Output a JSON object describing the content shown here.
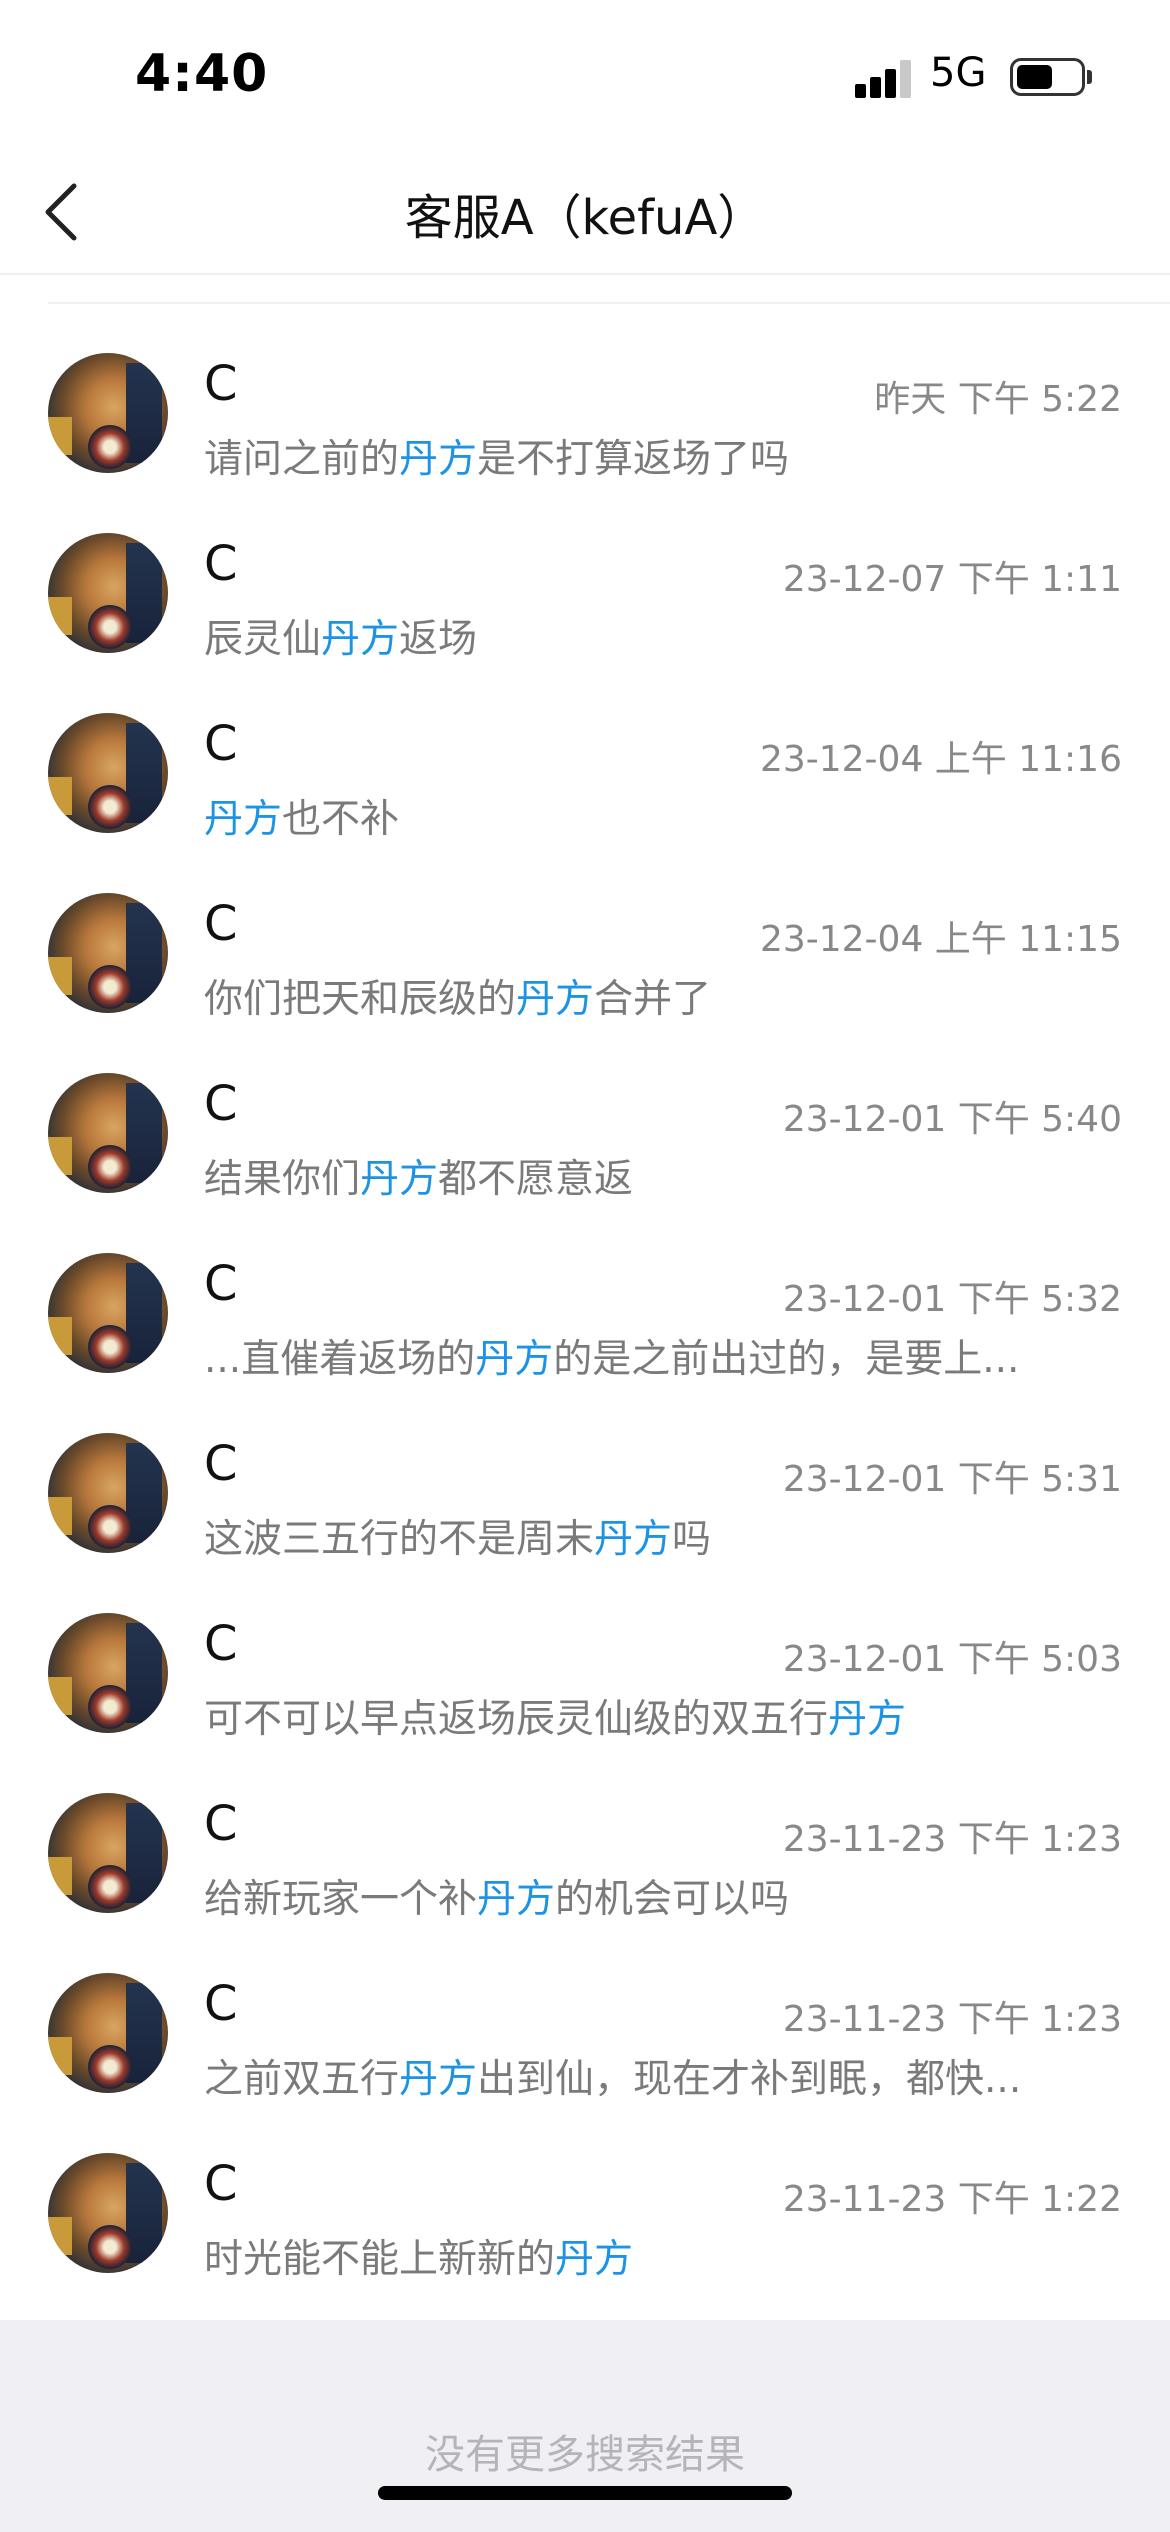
{
  "status_bar": {
    "time": "4:40",
    "network": "5G",
    "battery_level": 0.55
  },
  "nav": {
    "title": "客服A（kefuA）"
  },
  "results": [
    {
      "name": "C",
      "time": "昨天 下午 5:22",
      "pre": "请问之前的",
      "keyword": "丹方",
      "post": "是不打算返场了吗"
    },
    {
      "name": "C",
      "time": "23-12-07 下午 1:11",
      "pre": "辰灵仙",
      "keyword": "丹方",
      "post": "返场"
    },
    {
      "name": "C",
      "time": "23-12-04 上午 11:16",
      "pre": "",
      "keyword": "丹方",
      "post": "也不补"
    },
    {
      "name": "C",
      "time": "23-12-04 上午 11:15",
      "pre": "你们把天和辰级的",
      "keyword": "丹方",
      "post": "合并了"
    },
    {
      "name": "C",
      "time": "23-12-01 下午 5:40",
      "pre": "结果你们",
      "keyword": "丹方",
      "post": "都不愿意返"
    },
    {
      "name": "C",
      "time": "23-12-01 下午 5:32",
      "pre": "...直催着返场的",
      "keyword": "丹方",
      "post": "的是之前出过的，是要上..."
    },
    {
      "name": "C",
      "time": "23-12-01 下午 5:31",
      "pre": "这波三五行的不是周末",
      "keyword": "丹方",
      "post": "吗"
    },
    {
      "name": "C",
      "time": "23-12-01 下午 5:03",
      "pre": "可不可以早点返场辰灵仙级的双五行",
      "keyword": "丹方",
      "post": ""
    },
    {
      "name": "C",
      "time": "23-11-23 下午 1:23",
      "pre": "给新玩家一个补",
      "keyword": "丹方",
      "post": "的机会可以吗"
    },
    {
      "name": "C",
      "time": "23-11-23 下午 1:23",
      "pre": "之前双五行",
      "keyword": "丹方",
      "post": "出到仙，现在才补到眠，都快..."
    },
    {
      "name": "C",
      "time": "23-11-23 下午 1:22",
      "pre": "时光能不能上新新的",
      "keyword": "丹方",
      "post": ""
    }
  ],
  "footer": {
    "text": "没有更多搜索结果"
  },
  "colors": {
    "highlight": "#1c93e3",
    "message": "#7a7a7a",
    "time": "#888888",
    "footer_bg": "#efeff4"
  }
}
